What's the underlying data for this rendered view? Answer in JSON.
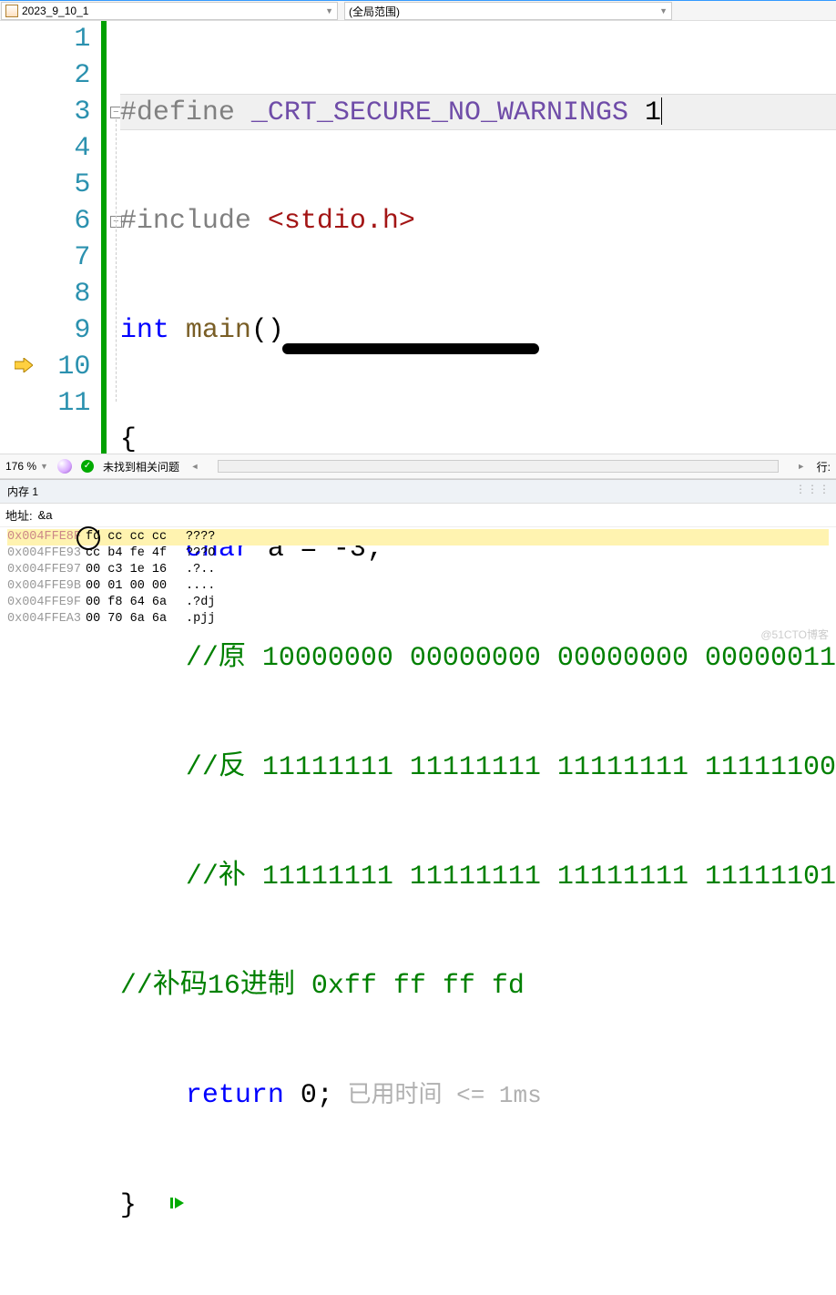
{
  "toolbar": {
    "file_label": "2023_9_10_1",
    "scope_label": "(全局范围)"
  },
  "code": {
    "lines": [
      "1",
      "2",
      "3",
      "4",
      "5",
      "6",
      "7",
      "8",
      "9",
      "10",
      "11"
    ],
    "l1_def": "#define",
    "l1_mac": "_CRT_SECURE_NO_WARNINGS",
    "l1_val": "1",
    "l2_inc": "#include",
    "l2_hdr": "<stdio.h>",
    "l3_kw": "int",
    "l3_fn": "main",
    "l3_rest": "()",
    "l4": "{",
    "l5_kw": "char",
    "l5_rest": " a = -3;",
    "l6_cm": "//原 10000000 00000000 00000000 00000011",
    "l7_cm": "//反 11111111 11111111 11111111 11111100",
    "l8_cm": "//补 11111111 11111111 11111111 11111101",
    "l9_cm": "//补码16进制 0xff ff ff fd",
    "l10_kw": "return",
    "l10_rest": " 0;",
    "l10_hint": " 已用时间 <= 1ms",
    "l11": "}"
  },
  "status": {
    "zoom": "176 %",
    "issues": "未找到相关问题",
    "line_label": "行:"
  },
  "memory": {
    "title": "内存 1",
    "addr_label": "地址:",
    "addr_value": "&a",
    "rows": [
      {
        "addr": "0x004FFE8F",
        "bytes": "fd cc cc cc",
        "ascii": "????",
        "hi": true
      },
      {
        "addr": "0x004FFE93",
        "bytes": "cc b4 fe 4f",
        "ascii": "???O",
        "hi": false
      },
      {
        "addr": "0x004FFE97",
        "bytes": "00 c3 1e 16",
        "ascii": ".?..",
        "hi": false
      },
      {
        "addr": "0x004FFE9B",
        "bytes": "00 01 00 00",
        "ascii": "....",
        "hi": false
      },
      {
        "addr": "0x004FFE9F",
        "bytes": "00 f8 64 6a",
        "ascii": ".?dj",
        "hi": false
      },
      {
        "addr": "0x004FFEA3",
        "bytes": "00 70 6a 6a",
        "ascii": ".pjj",
        "hi": false
      }
    ]
  },
  "watermark": "@51CTO博客"
}
